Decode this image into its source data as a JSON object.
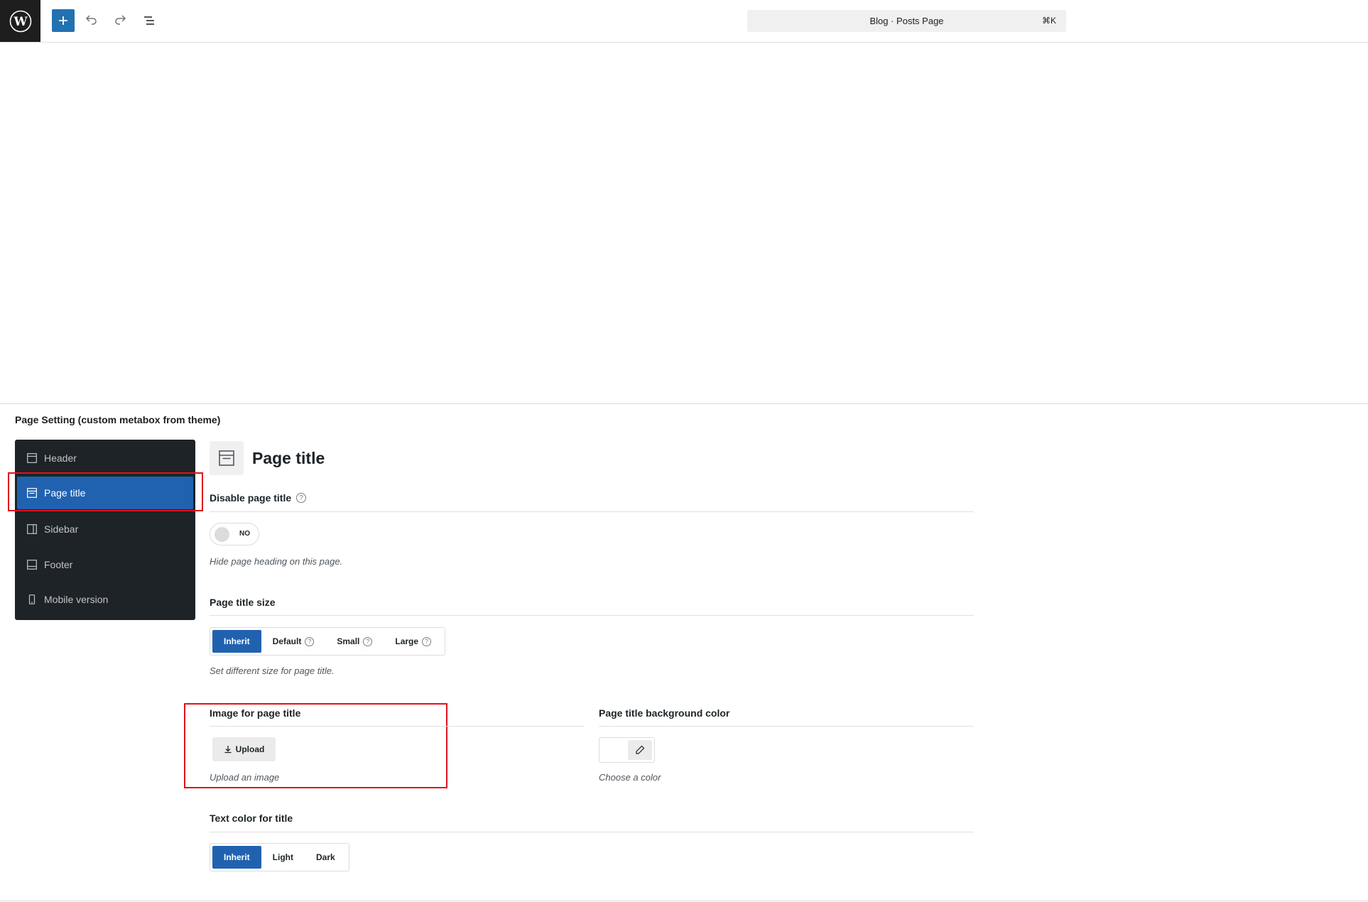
{
  "toolbar": {
    "logo_icon": "wordpress-logo-icon",
    "add_icon": "plus-icon",
    "undo_icon": "undo-icon",
    "redo_icon": "redo-icon",
    "list_view_icon": "list-view-icon",
    "command_title": "Blog · Posts Page",
    "command_shortcut": "⌘K"
  },
  "metabox": {
    "title": "Page Setting (custom metabox from theme)",
    "nav": [
      {
        "label": "Header",
        "icon": "header-layout-icon",
        "active": false
      },
      {
        "label": "Page title",
        "icon": "page-title-layout-icon",
        "active": true
      },
      {
        "label": "Sidebar",
        "icon": "sidebar-layout-icon",
        "active": false
      },
      {
        "label": "Footer",
        "icon": "footer-layout-icon",
        "active": false
      },
      {
        "label": "Mobile version",
        "icon": "mobile-icon",
        "active": false
      }
    ]
  },
  "panel": {
    "title": "Page title",
    "icon": "page-title-layout-icon",
    "disable_title": {
      "label": "Disable page title",
      "help": "?",
      "toggle_text": "NO",
      "toggle_on": false,
      "description": "Hide page heading on this page."
    },
    "title_size": {
      "label": "Page title size",
      "options": [
        {
          "label": "Inherit",
          "selected": true,
          "help": ""
        },
        {
          "label": "Default",
          "selected": false,
          "help": "?"
        },
        {
          "label": "Small",
          "selected": false,
          "help": "?"
        },
        {
          "label": "Large",
          "selected": false,
          "help": "?"
        }
      ],
      "description": "Set different size for page title."
    },
    "image": {
      "label": "Image for page title",
      "button": "Upload",
      "button_icon": "download-icon",
      "description": "Upload an image"
    },
    "bg_color": {
      "label": "Page title background color",
      "picker_icon": "eyedropper-icon",
      "description": "Choose a color"
    },
    "text_color": {
      "label": "Text color for title",
      "options": [
        {
          "label": "Inherit",
          "selected": true
        },
        {
          "label": "Light",
          "selected": false
        },
        {
          "label": "Dark",
          "selected": false
        }
      ]
    }
  },
  "colors": {
    "accent": "#2062b0",
    "highlight": "#e0131b",
    "nav_bg": "#1d2327"
  }
}
